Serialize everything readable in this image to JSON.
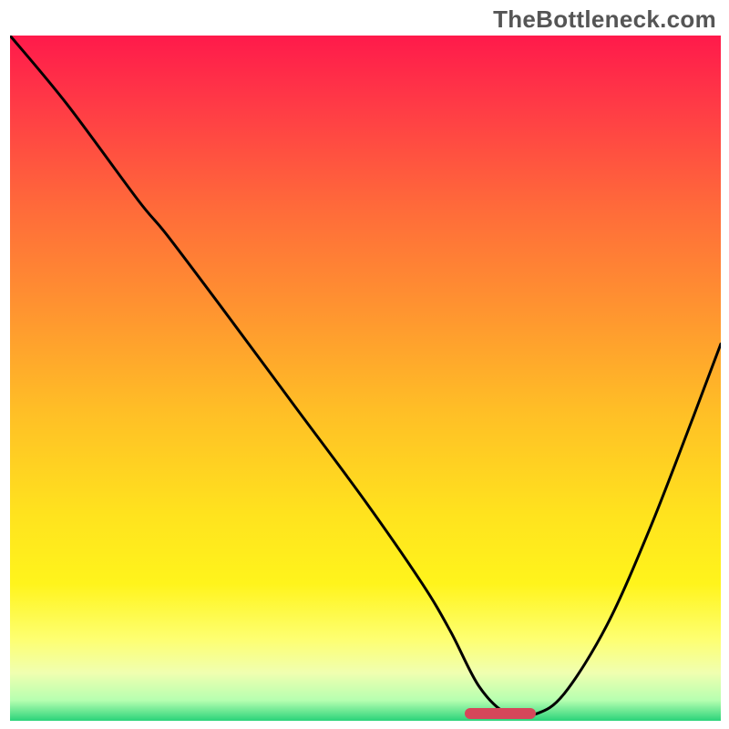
{
  "watermark": "TheBottleneck.com",
  "chart_data": {
    "type": "line",
    "title": "",
    "xlabel": "",
    "ylabel": "",
    "xlim": [
      0,
      100
    ],
    "ylim": [
      0,
      100
    ],
    "grid": false,
    "legend": false,
    "series": [
      {
        "name": "bottleneck-curve",
        "color": "#000000",
        "x": [
          0,
          8,
          18,
          22,
          30,
          40,
          50,
          58,
          62,
          66,
          70,
          74,
          78,
          84,
          90,
          96,
          100
        ],
        "y": [
          100,
          90,
          76,
          71,
          60,
          46,
          32,
          20,
          13,
          5,
          1,
          1,
          4,
          14,
          28,
          44,
          55
        ]
      }
    ],
    "marker": {
      "x_start": 64,
      "x_end": 74,
      "y": 1,
      "color": "#d6475a"
    },
    "background_gradient": {
      "type": "vertical",
      "stops": [
        {
          "pos": 0.0,
          "color": "#ff1a4b"
        },
        {
          "pos": 0.1,
          "color": "#ff3a46"
        },
        {
          "pos": 0.25,
          "color": "#ff6a3a"
        },
        {
          "pos": 0.4,
          "color": "#ff9430"
        },
        {
          "pos": 0.55,
          "color": "#ffbf26"
        },
        {
          "pos": 0.7,
          "color": "#ffe31e"
        },
        {
          "pos": 0.8,
          "color": "#fff41c"
        },
        {
          "pos": 0.88,
          "color": "#feff70"
        },
        {
          "pos": 0.93,
          "color": "#f0ffb0"
        },
        {
          "pos": 0.97,
          "color": "#b6ffb0"
        },
        {
          "pos": 1.0,
          "color": "#2bd37a"
        }
      ]
    }
  }
}
